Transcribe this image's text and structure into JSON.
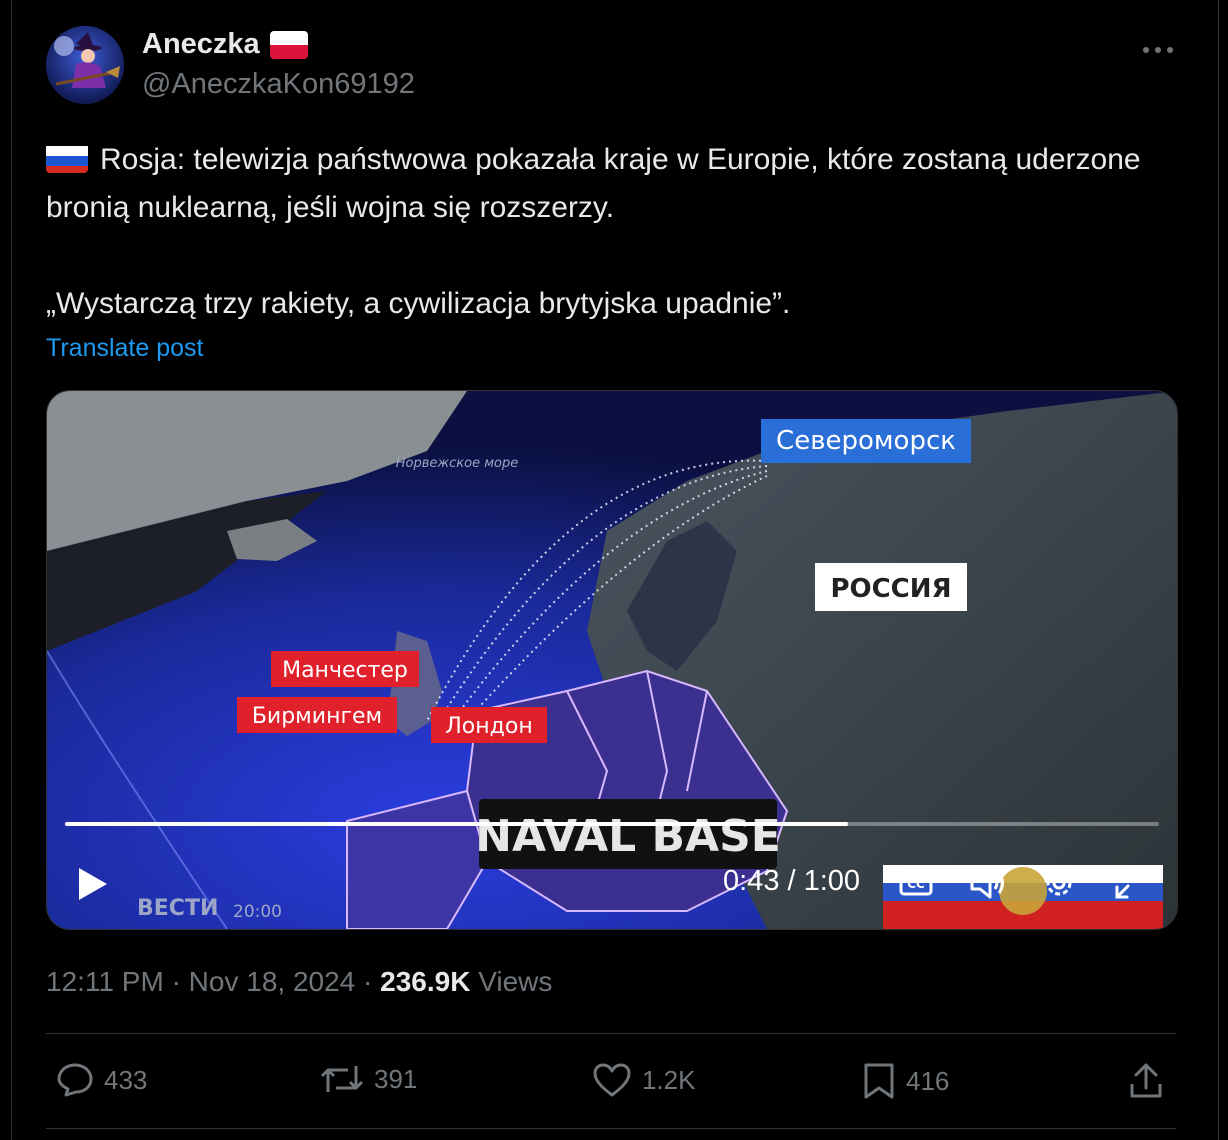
{
  "author": {
    "name": "Aneczka",
    "handle": "@AneczkaKon69192",
    "name_flag": "poland-flag-icon",
    "avatar": "witch-avatar"
  },
  "more_icon": "more-options-icon",
  "post": {
    "flag": "russia-flag-icon",
    "paragraph1": "Rosja: telewizja państwowa pokazała kraje w Europie, które zostaną uderzone bronią nuklearną, jeśli wojna się rozszerzy.",
    "paragraph2": "„Wystarczą trzy rakiety, a cywilizacja brytyjska upadnie”.",
    "translate_label": "Translate post"
  },
  "video": {
    "labels": {
      "severomorsk": "Североморск",
      "russia": "РОССИЯ",
      "manchester": "Манчестер",
      "birmingham": "Бирмингем",
      "london": "Лондон",
      "sea": "Норвежское море",
      "naval_base": "NAVAL BASE",
      "channel": "ВЕСТИ",
      "channel_time": "20:00"
    },
    "time_display": "0:43 / 1:00",
    "progress_fraction": 0.716,
    "controls": [
      "play-icon",
      "captions-icon",
      "volume-icon",
      "settings-icon",
      "fullscreen-icon"
    ]
  },
  "meta": {
    "time": "12:11 PM",
    "date": "Nov 18, 2024",
    "separator": "·",
    "views_count": "236.9K",
    "views_label": "Views"
  },
  "actions": {
    "replies": "433",
    "reposts": "391",
    "likes": "1.2K",
    "bookmarks": "416"
  },
  "colors": {
    "background": "#000000",
    "text": "#e7e9ea",
    "muted": "#71767b",
    "link": "#1d9bf0",
    "divider": "#2f3336"
  }
}
